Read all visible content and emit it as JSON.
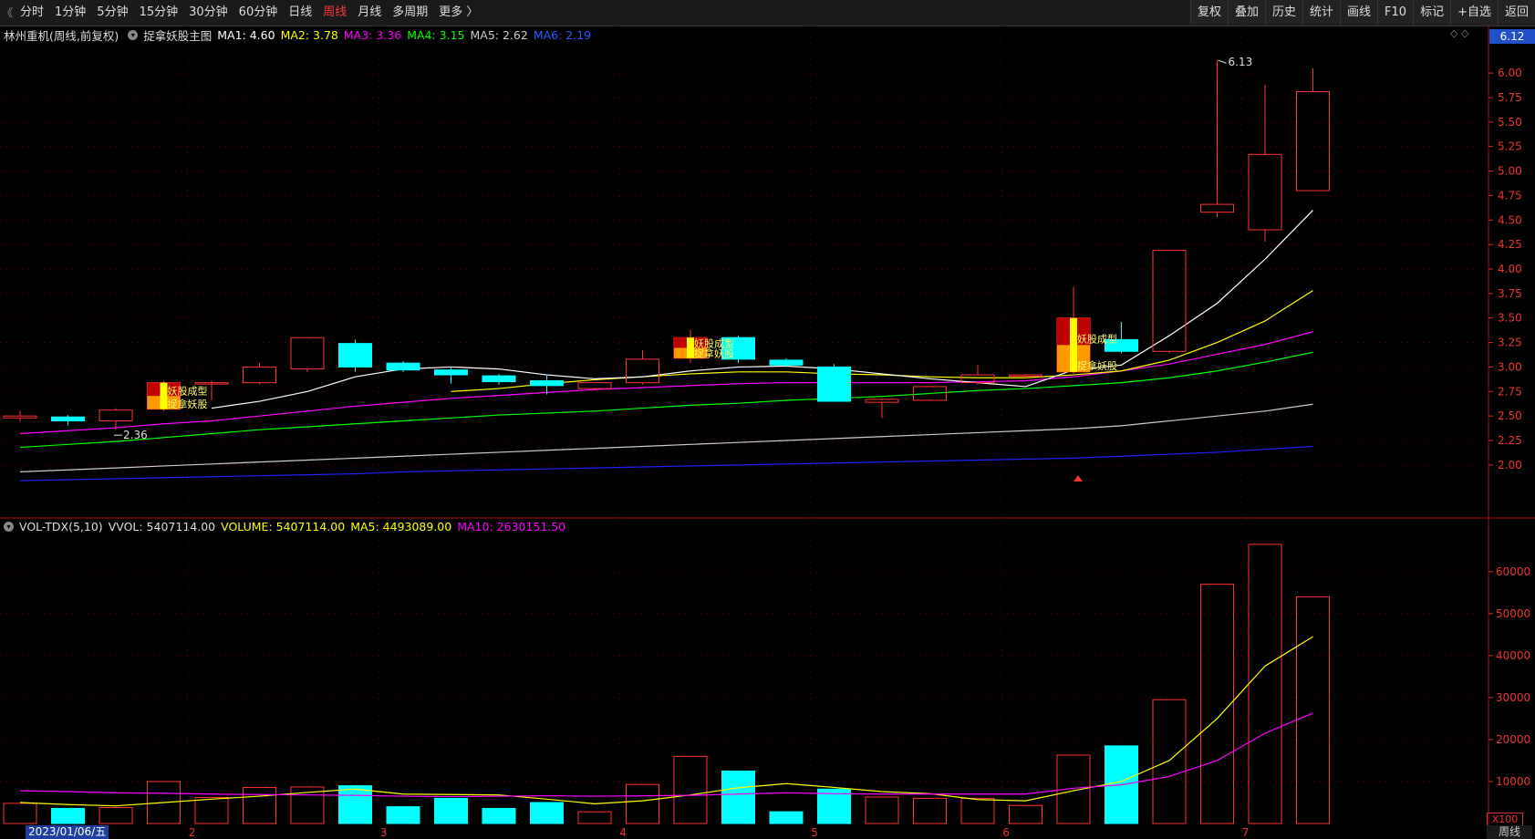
{
  "toolbar": {
    "collapse": "《",
    "periods": [
      "分时",
      "1分钟",
      "5分钟",
      "15分钟",
      "30分钟",
      "60分钟",
      "日线",
      "周线",
      "月线",
      "多周期",
      "更多 〉"
    ],
    "active_period": "周线",
    "right_buttons": [
      "复权",
      "叠加",
      "历史",
      "统计",
      "画线",
      "F10",
      "标记",
      "+自选",
      "返回"
    ]
  },
  "main_info": {
    "stock": "林州重机(周线,前复权)",
    "indicator": "捉拿妖股主图",
    "ma1": "MA1: 4.60",
    "ma2": "MA2: 3.78",
    "ma3": "MA3: 3.36",
    "ma4": "MA4: 3.15",
    "ma5": "MA5: 2.62",
    "ma6": "MA6: 2.19"
  },
  "vol_info": {
    "name": "VOL-TDX(5,10)",
    "vvol": "VVOL: 5407114.00",
    "volume": "VOLUME: 5407114.00",
    "ma5": "MA5: 4493089.00",
    "ma10": "MA10: 2630151.50"
  },
  "price_tag": "6.12",
  "corner_icons": "◇ ◇",
  "x100": "X100",
  "period_label": "周线",
  "date_label": "2023/01/06/五",
  "colors": {
    "up": "#ff3333",
    "down": "#00ffff",
    "ma1": "#ffffff",
    "ma2": "#ffff00",
    "ma3": "#ff00ff",
    "ma4": "#00ff00",
    "ma5": "#cccccc",
    "ma6": "#2020ff"
  },
  "chart_data": {
    "type": "candlestick",
    "price_axis": {
      "min": 2.0,
      "max": 6.0,
      "ticks": [
        "6.00",
        "5.75",
        "5.50",
        "5.25",
        "5.00",
        "4.75",
        "4.50",
        "4.25",
        "4.00",
        "3.75",
        "3.50",
        "3.25",
        "3.00",
        "2.75",
        "2.50",
        "2.25",
        "2.00"
      ]
    },
    "volume_axis": {
      "max": 60000,
      "ticks": [
        "60000",
        "50000",
        "40000",
        "30000",
        "20000",
        "10000"
      ]
    },
    "month_labels": [
      "2",
      "3",
      "4",
      "5",
      "6",
      "7"
    ],
    "month_index": [
      3.5,
      7.5,
      12.5,
      16.5,
      20.5,
      25.5
    ],
    "high_label": "6.13",
    "low_label": "2.36",
    "signal_text": [
      "妖股成型",
      "捉拿妖股"
    ],
    "signals_at": [
      3,
      14,
      22
    ],
    "candles": [
      {
        "o": 2.48,
        "h": 2.55,
        "l": 2.44,
        "c": 2.5
      },
      {
        "o": 2.49,
        "h": 2.51,
        "l": 2.4,
        "c": 2.45
      },
      {
        "o": 2.45,
        "h": 2.58,
        "l": 2.36,
        "c": 2.56
      },
      {
        "o": 2.57,
        "h": 2.86,
        "l": 2.55,
        "c": 2.84
      },
      {
        "o": 2.84,
        "h": 2.86,
        "l": 2.66,
        "c": 2.84
      },
      {
        "o": 2.84,
        "h": 3.04,
        "l": 2.82,
        "c": 3.0
      },
      {
        "o": 2.98,
        "h": 3.3,
        "l": 2.95,
        "c": 3.3
      },
      {
        "o": 3.24,
        "h": 3.28,
        "l": 2.95,
        "c": 3.0
      },
      {
        "o": 3.04,
        "h": 3.06,
        "l": 2.95,
        "c": 2.97
      },
      {
        "o": 2.97,
        "h": 3.0,
        "l": 2.83,
        "c": 2.92
      },
      {
        "o": 2.91,
        "h": 2.93,
        "l": 2.82,
        "c": 2.85
      },
      {
        "o": 2.86,
        "h": 2.92,
        "l": 2.72,
        "c": 2.81
      },
      {
        "o": 2.78,
        "h": 2.84,
        "l": 2.76,
        "c": 2.84
      },
      {
        "o": 2.84,
        "h": 3.17,
        "l": 2.82,
        "c": 3.08
      },
      {
        "o": 3.09,
        "h": 3.38,
        "l": 3.04,
        "c": 3.3
      },
      {
        "o": 3.3,
        "h": 3.32,
        "l": 3.04,
        "c": 3.08
      },
      {
        "o": 3.07,
        "h": 3.09,
        "l": 3.0,
        "c": 3.02
      },
      {
        "o": 3.0,
        "h": 3.03,
        "l": 2.65,
        "c": 2.65
      },
      {
        "o": 2.64,
        "h": 2.66,
        "l": 2.48,
        "c": 2.67
      },
      {
        "o": 2.66,
        "h": 2.8,
        "l": 2.66,
        "c": 2.8
      },
      {
        "o": 2.84,
        "h": 3.02,
        "l": 2.82,
        "c": 2.92
      },
      {
        "o": 2.91,
        "h": 2.93,
        "l": 2.88,
        "c": 2.92
      },
      {
        "o": 2.95,
        "h": 3.82,
        "l": 2.93,
        "c": 3.5
      },
      {
        "o": 3.28,
        "h": 3.46,
        "l": 3.14,
        "c": 3.16
      },
      {
        "o": 3.16,
        "h": 4.19,
        "l": 3.14,
        "c": 4.19
      },
      {
        "o": 4.58,
        "h": 6.13,
        "l": 4.53,
        "c": 4.66
      },
      {
        "o": 4.4,
        "h": 5.88,
        "l": 4.28,
        "c": 5.17
      },
      {
        "o": 4.8,
        "h": 6.05,
        "l": 4.8,
        "c": 5.81
      }
    ],
    "ma1": [
      null,
      null,
      null,
      null,
      2.58,
      2.65,
      2.75,
      2.9,
      2.98,
      3.0,
      2.98,
      2.92,
      2.88,
      2.9,
      2.96,
      3.0,
      3.01,
      2.98,
      2.93,
      2.88,
      2.84,
      2.8,
      2.97,
      3.02,
      3.32,
      3.65,
      4.1,
      4.6
    ],
    "ma2": [
      null,
      null,
      null,
      null,
      null,
      null,
      null,
      null,
      null,
      2.75,
      2.78,
      2.83,
      2.87,
      2.9,
      2.93,
      2.95,
      2.95,
      2.93,
      2.92,
      2.9,
      2.89,
      2.89,
      2.92,
      2.96,
      3.07,
      3.25,
      3.47,
      3.78
    ],
    "ma3": [
      2.32,
      2.35,
      2.38,
      2.42,
      2.45,
      2.5,
      2.55,
      2.6,
      2.64,
      2.68,
      2.71,
      2.74,
      2.77,
      2.79,
      2.81,
      2.83,
      2.84,
      2.84,
      2.84,
      2.84,
      2.85,
      2.86,
      2.9,
      2.96,
      3.03,
      3.13,
      3.23,
      3.36
    ],
    "ma4": [
      2.18,
      2.21,
      2.24,
      2.28,
      2.32,
      2.36,
      2.39,
      2.42,
      2.45,
      2.48,
      2.51,
      2.53,
      2.55,
      2.58,
      2.61,
      2.63,
      2.66,
      2.68,
      2.7,
      2.73,
      2.76,
      2.78,
      2.81,
      2.84,
      2.89,
      2.96,
      3.05,
      3.15
    ],
    "ma5": [
      1.93,
      1.95,
      1.97,
      1.99,
      2.01,
      2.03,
      2.05,
      2.07,
      2.09,
      2.11,
      2.13,
      2.15,
      2.17,
      2.19,
      2.21,
      2.23,
      2.25,
      2.27,
      2.29,
      2.31,
      2.33,
      2.35,
      2.37,
      2.4,
      2.45,
      2.5,
      2.55,
      2.62
    ],
    "ma6": [
      1.84,
      1.85,
      1.86,
      1.87,
      1.88,
      1.89,
      1.9,
      1.91,
      1.93,
      1.94,
      1.95,
      1.96,
      1.97,
      1.98,
      1.99,
      2.0,
      2.01,
      2.02,
      2.03,
      2.04,
      2.05,
      2.06,
      2.07,
      2.09,
      2.11,
      2.13,
      2.16,
      2.19
    ],
    "volume": [
      4800,
      3600,
      3800,
      10000,
      6200,
      8600,
      8700,
      9000,
      4000,
      6000,
      3600,
      5000,
      2800,
      9300,
      16000,
      12500,
      2800,
      8200,
      6300,
      6000,
      6000,
      4300,
      16300,
      18500,
      29500,
      57000,
      66500,
      54000
    ],
    "vol_ma5": [
      5000,
      4500,
      4200,
      5000,
      5800,
      6500,
      7400,
      8200,
      7000,
      6900,
      6800,
      5800,
      4700,
      5400,
      6800,
      8500,
      9500,
      8600,
      7600,
      7100,
      5700,
      5400,
      7800,
      10000,
      15000,
      25000,
      37500,
      44500
    ],
    "vol_ma10": [
      7800,
      7600,
      7300,
      7200,
      7000,
      6900,
      6800,
      6700,
      6500,
      6400,
      6500,
      6600,
      6500,
      6600,
      6700,
      7000,
      7300,
      7100,
      7000,
      7000,
      7000,
      7000,
      8400,
      9200,
      11200,
      15000,
      21500,
      26300
    ]
  }
}
